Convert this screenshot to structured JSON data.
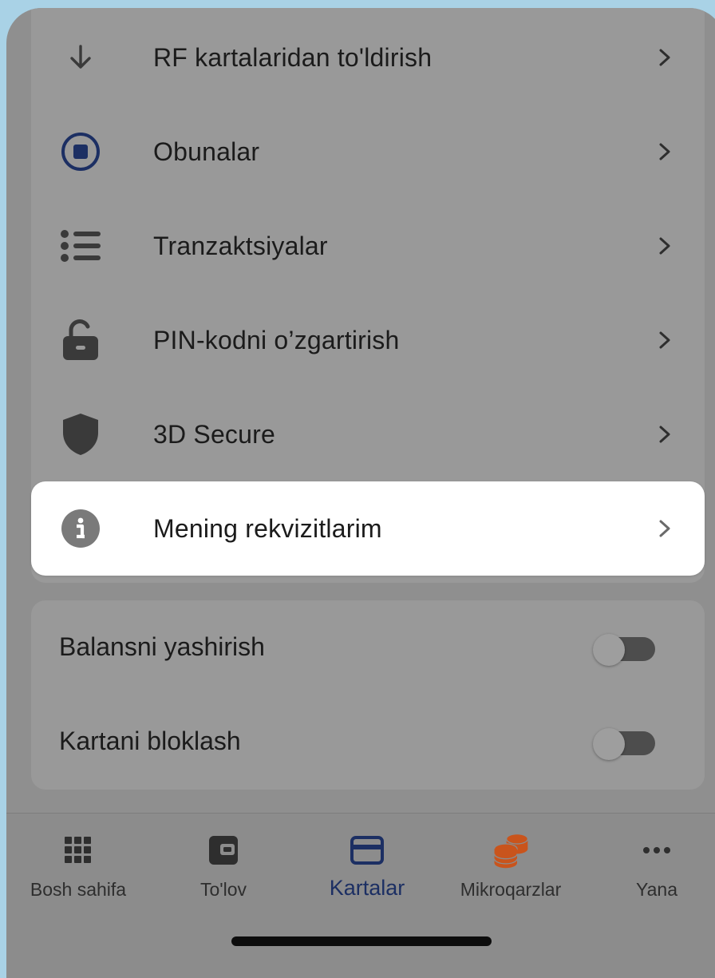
{
  "menu": {
    "items": [
      {
        "label": "RF kartalaridan to'ldirish",
        "icon": "arrow-down-icon"
      },
      {
        "label": "Obunalar",
        "icon": "subscription-stop-icon"
      },
      {
        "label": "Tranzaktsiyalar",
        "icon": "list-icon"
      },
      {
        "label": "PIN-kodni o’zgartirish",
        "icon": "unlock-icon"
      },
      {
        "label": "3D Secure",
        "icon": "shield-icon"
      },
      {
        "label": "Mening rekvizitlarim",
        "icon": "info-icon",
        "highlighted": true
      }
    ]
  },
  "toggles": [
    {
      "label": "Balansni yashirish",
      "on": false
    },
    {
      "label": "Kartani bloklash",
      "on": false
    }
  ],
  "bottom_nav": {
    "items": [
      {
        "label": "Bosh sahifa",
        "icon": "grid-icon"
      },
      {
        "label": "To'lov",
        "icon": "wallet-icon"
      },
      {
        "label": "Kartalar",
        "icon": "card-icon",
        "active": true
      },
      {
        "label": "Mikroqarzlar",
        "icon": "coins-icon"
      },
      {
        "label": "Yana",
        "icon": "more-icon"
      }
    ]
  },
  "colors": {
    "accent": "#1c2f63",
    "coins": "#c9541c",
    "highlight_bg": "#ffffff",
    "overlay_bg": "#8f8f8f"
  }
}
